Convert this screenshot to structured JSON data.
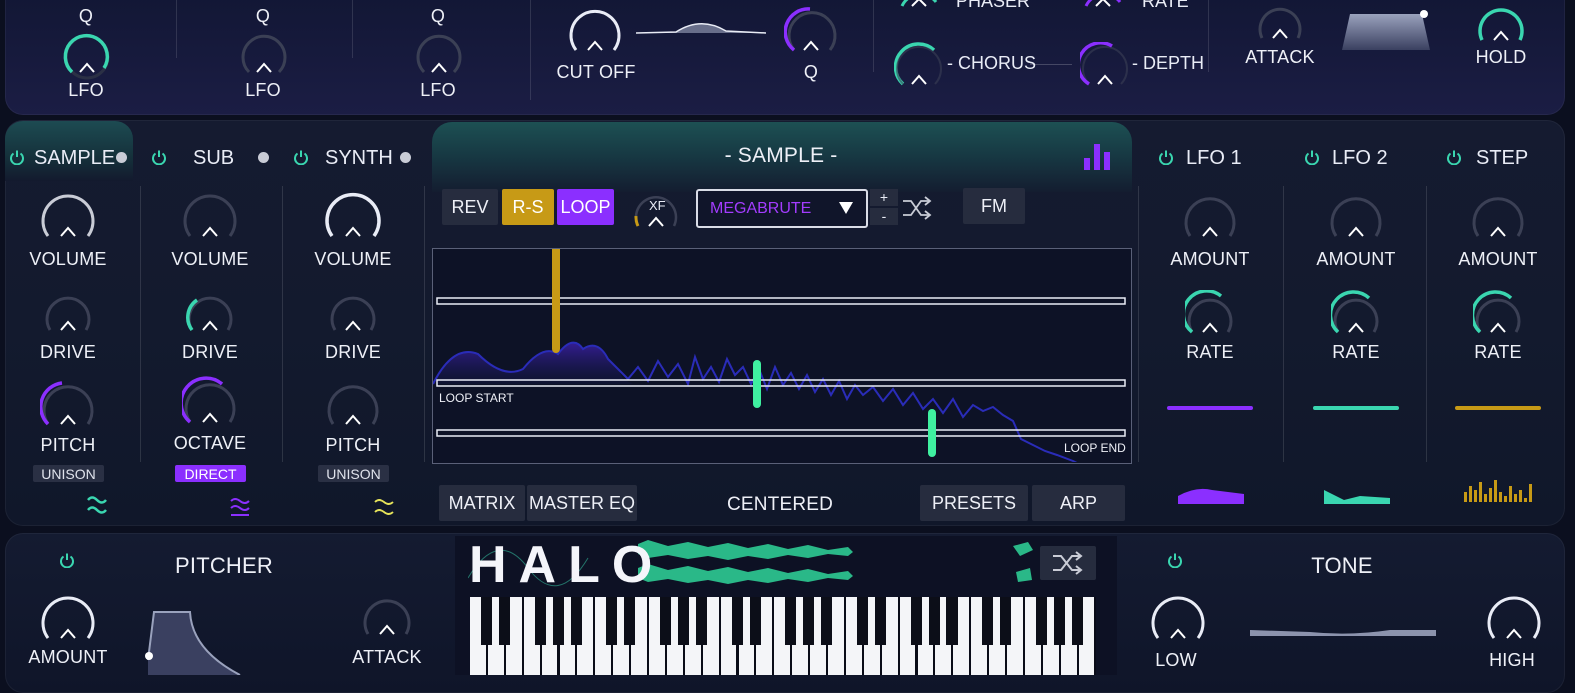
{
  "colors": {
    "teal": "#3ad6b0",
    "purple": "#8b2fff",
    "gold": "#c79a16",
    "mint": "#3ff0a0",
    "navy": "#1b1e7a"
  },
  "top": {
    "q_labels": [
      "Q",
      "Q",
      "Q"
    ],
    "lfo_labels": [
      "LFO",
      "LFO",
      "LFO"
    ],
    "cutoff": "CUT OFF",
    "q2": "Q",
    "phaser": "PHASER",
    "chorus": "- CHORUS",
    "rate": "RATE",
    "depth": "- DEPTH",
    "attack": "ATTACK",
    "hold": "HOLD"
  },
  "tabs": {
    "sample": "SAMPLE",
    "sub": "SUB",
    "synth": "SYNTH"
  },
  "cols": {
    "sample": {
      "volume": "VOLUME",
      "drive": "DRIVE",
      "pitch": "PITCH",
      "badge": "UNISON"
    },
    "sub": {
      "volume": "VOLUME",
      "drive": "DRIVE",
      "octave": "OCTAVE",
      "badge": "DIRECT"
    },
    "synth": {
      "volume": "VOLUME",
      "drive": "DRIVE",
      "pitch": "PITCH",
      "badge": "UNISON"
    }
  },
  "center": {
    "title": "- SAMPLE -",
    "rev": "REV",
    "rs": "R-S",
    "loop": "LOOP",
    "xf": "XF",
    "preset": "MEGABRUTE",
    "plus": "+",
    "minus": "-",
    "fm": "FM",
    "loop_start": "LOOP START",
    "loop_end": "LOOP END",
    "matrix": "MATRIX",
    "master_eq": "MASTER EQ",
    "mode": "CENTERED",
    "presets": "PRESETS",
    "arp": "ARP"
  },
  "right": {
    "lfo1": "LFO 1",
    "lfo2": "LFO 2",
    "step": "STEP",
    "amount": "AMOUNT",
    "rate": "RATE"
  },
  "bottom": {
    "pitcher": "PITCHER",
    "amount": "AMOUNT",
    "attack": "ATTACK",
    "logo": "HALO",
    "tone": "TONE",
    "low": "LOW",
    "high": "HIGH"
  }
}
